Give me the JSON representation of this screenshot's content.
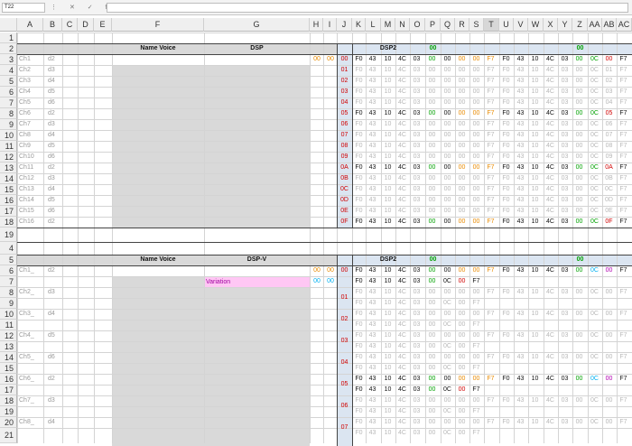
{
  "formula_bar": {
    "name_box": "T22",
    "icons": "⋮ ✕ ✓ fx",
    "content": ""
  },
  "columns": [
    "",
    "A",
    "B",
    "C",
    "D",
    "E",
    "F",
    "G",
    "H",
    "I",
    "J",
    "K",
    "L",
    "M",
    "N",
    "O",
    "P",
    "Q",
    "R",
    "S",
    "T",
    "U",
    "V",
    "W",
    "X",
    "Y",
    "Z",
    "AA",
    "AB",
    "AC"
  ],
  "rows": [
    "1",
    "2",
    "3",
    "4",
    "5",
    "6",
    "7",
    "8",
    "9",
    "10",
    "11",
    "12",
    "13",
    "14",
    "15",
    "16",
    "17",
    "18",
    "19",
    "4",
    "5",
    "6",
    "7",
    "8",
    "9",
    "10",
    "11",
    "12",
    "13",
    "14",
    "15",
    "16",
    "17",
    "18",
    "19",
    "20",
    "21"
  ],
  "top": {
    "name_voice": "Name Voice",
    "dsp": "DSP",
    "dsp2": "DSP2",
    "zero1": "00",
    "zero2": "00",
    "h3": "00",
    "i3": "00",
    "channels": [
      [
        "Ch1",
        "d2"
      ],
      [
        "Ch2",
        "d3"
      ],
      [
        "Ch3",
        "d4"
      ],
      [
        "Ch4",
        "d5"
      ],
      [
        "Ch5",
        "d6"
      ],
      [
        "Ch6",
        "d2"
      ],
      [
        "Ch7",
        "d3"
      ],
      [
        "Ch8",
        "d4"
      ],
      [
        "Ch9",
        "d5"
      ],
      [
        "Ch10",
        "d6"
      ],
      [
        "Ch11",
        "d2"
      ],
      [
        "Ch12",
        "d3"
      ],
      [
        "Ch13",
        "d4"
      ],
      [
        "Ch14",
        "d5"
      ],
      [
        "Ch15",
        "d6"
      ],
      [
        "Ch16",
        "d2"
      ]
    ],
    "jvals": [
      "00",
      "01",
      "02",
      "03",
      "04",
      "05",
      "06",
      "07",
      "08",
      "09",
      "0A",
      "0B",
      "0C",
      "0D",
      "0E",
      "0F"
    ]
  },
  "bottom": {
    "name_voice": "Name Voice",
    "dsp": "DSP-V",
    "dsp2": "DSP2",
    "zero1": "00",
    "zero2": "00",
    "variation": "Variation",
    "h5": "00",
    "i5": "00",
    "h6": "00",
    "i6": "00",
    "channels": [
      [
        "Ch1_",
        "d2"
      ],
      [
        "Ch2_",
        "d3"
      ],
      [
        "Ch3_",
        "d4"
      ],
      [
        "Ch4_",
        "d5"
      ],
      [
        "Ch5_",
        "d6"
      ],
      [
        "Ch6_",
        "d2"
      ],
      [
        "Ch7_",
        "d3"
      ],
      [
        "Ch8_",
        "d4"
      ]
    ],
    "jvals": [
      "00",
      "01",
      "02",
      "03",
      "04",
      "05",
      "06",
      "07"
    ]
  },
  "hexrow": [
    "F0",
    "43",
    "10",
    "4C",
    "03",
    "00",
    "00",
    "00",
    "00",
    "F7",
    "F0",
    "43",
    "10",
    "4C",
    "03",
    "00",
    "0C",
    "00",
    "F7"
  ]
}
